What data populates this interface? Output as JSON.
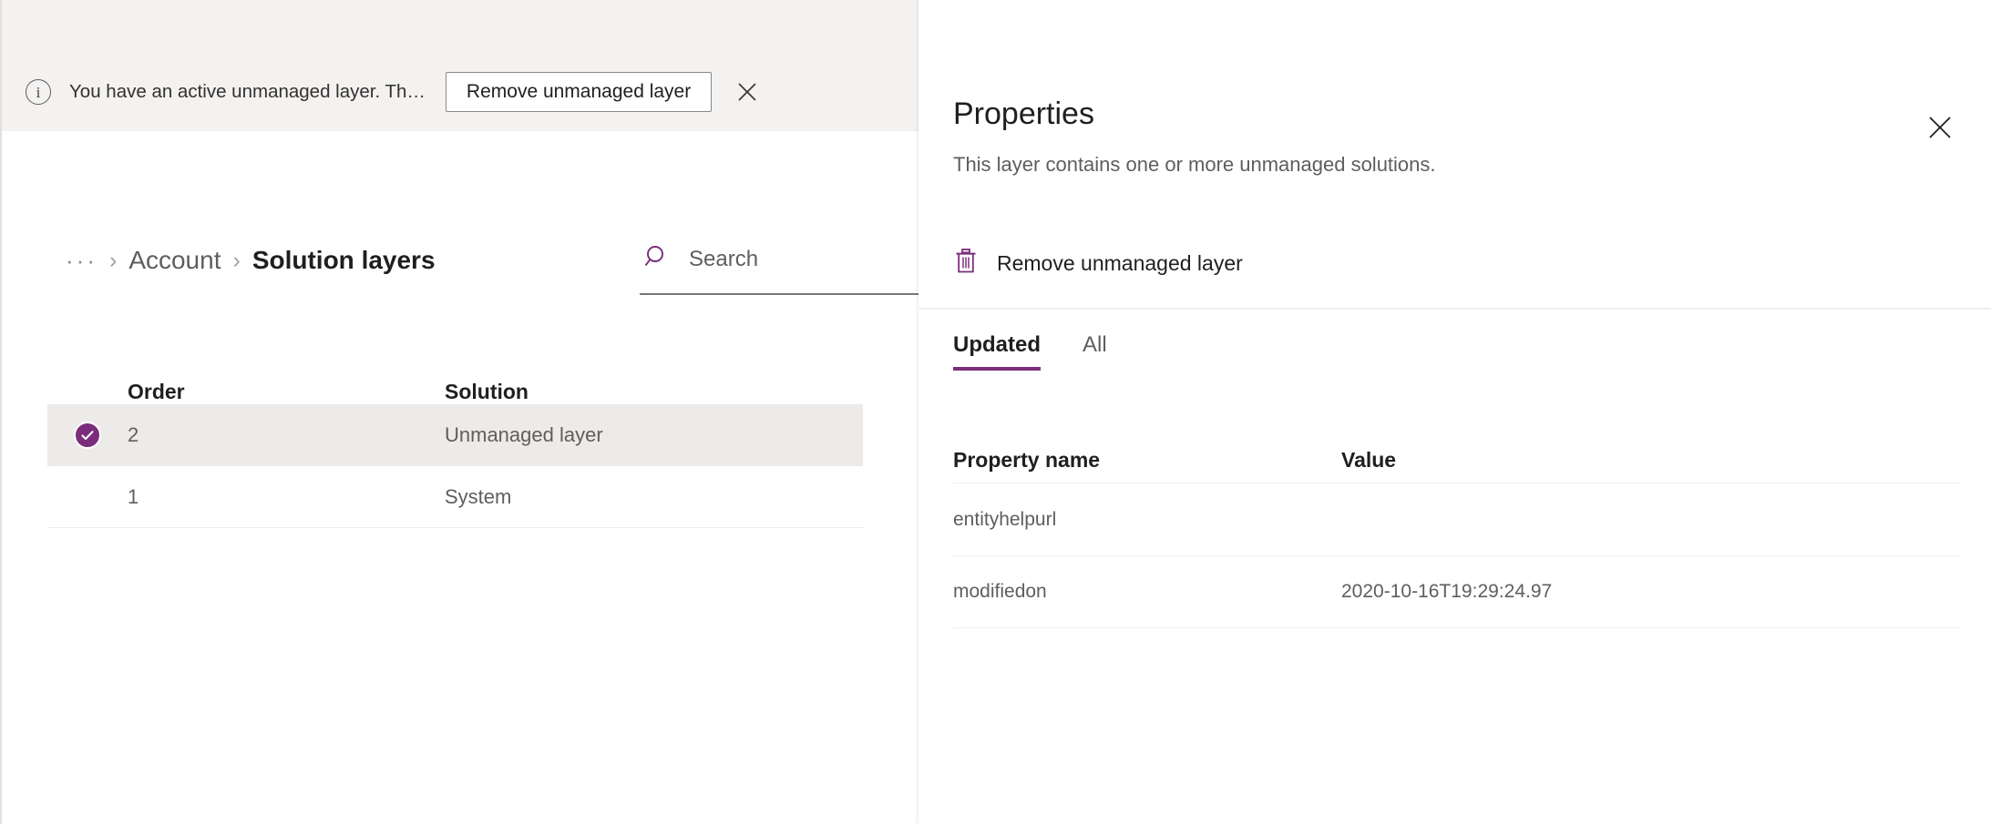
{
  "notification": {
    "icon": "info-icon",
    "message": "You have an active unmanaged layer. Th…",
    "action_label": "Remove unmanaged layer",
    "close_icon": "close-icon"
  },
  "breadcrumb": {
    "ellipsis": "···",
    "separator": "›",
    "parent": "Account",
    "current": "Solution layers"
  },
  "search": {
    "icon": "search-icon",
    "placeholder": "Search",
    "value": ""
  },
  "layers_table": {
    "columns": [
      "Order",
      "Solution"
    ],
    "rows": [
      {
        "order": "2",
        "solution": "Unmanaged layer",
        "selected": true
      },
      {
        "order": "1",
        "solution": "System",
        "selected": false
      }
    ]
  },
  "panel": {
    "title": "Properties",
    "subtitle": "This layer contains one or more unmanaged solutions.",
    "close_icon": "close-icon",
    "command": {
      "icon": "trash-icon",
      "label": "Remove unmanaged layer"
    },
    "tabs": [
      {
        "label": "Updated",
        "active": true
      },
      {
        "label": "All",
        "active": false
      }
    ],
    "properties_table": {
      "columns": [
        "Property name",
        "Value"
      ],
      "rows": [
        {
          "name": "entityhelpurl",
          "value": ""
        },
        {
          "name": "modifiedon",
          "value": "2020-10-16T19:29:24.97"
        }
      ]
    }
  },
  "colors": {
    "accent": "#7b2d7b",
    "notification_bg": "#f3f2f1",
    "row_selected_bg": "#edebe9",
    "text_primary": "#201f1e",
    "text_secondary": "#605e5c"
  }
}
